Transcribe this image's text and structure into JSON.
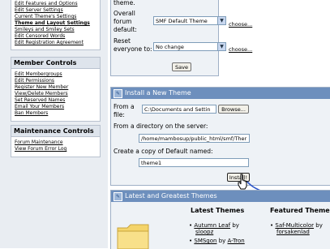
{
  "sidebar": {
    "top_links": [
      {
        "label": "Edit Features and Options",
        "bold": false
      },
      {
        "label": "Edit Server Settings",
        "bold": false
      },
      {
        "label": "Current Theme's Settings",
        "bold": false
      },
      {
        "label": "Theme and Layout Settings",
        "bold": true
      },
      {
        "label": "Smileys and Smiley Sets",
        "bold": false
      },
      {
        "label": "Edit Censored Words",
        "bold": false
      },
      {
        "label": "Edit Registration Agreement",
        "bold": false
      }
    ],
    "member_controls": {
      "title": "Member Controls",
      "links": [
        "Edit Membergroups",
        "Edit Permissions",
        "Register New Member",
        "View/Delete Members",
        "Set Reserved Names",
        "Email Your Members",
        "Ban Members"
      ]
    },
    "maintenance_controls": {
      "title": "Maintenance Controls",
      "links": [
        "Forum Maintenance",
        "View Forum Error Log"
      ]
    }
  },
  "settings_box": {
    "top_text": "theme.",
    "overall_label_lines": [
      "Overall",
      "forum",
      "default:"
    ],
    "overall_value": "SMF Default Theme",
    "reset_label_lines": [
      "Reset",
      "everyone to:"
    ],
    "reset_value": "No change",
    "choose_link": "choose...",
    "save_label": "Save"
  },
  "install_box": {
    "title": "Install a New Theme",
    "from_file_label_lines": [
      "From a",
      "file:"
    ],
    "file_value": "C:\\Documents and Settin",
    "browse_label": "Browse...",
    "from_dir_label": "From a directory on the server:",
    "dir_value": "/home/mambosup/public_html/smf/Ther",
    "copy_label": "Create a copy of Default named:",
    "copy_value": "theme1",
    "install_label": "Install!"
  },
  "latest_box": {
    "title": "Latest and Greatest Themes",
    "latest_heading": "Latest Themes",
    "featured_heading": "Featured Theme",
    "latest_items": [
      {
        "name": "Autumn Leaf",
        "by": "by",
        "author": "sloopz"
      },
      {
        "name": "SMSgon",
        "by": "by",
        "author": "A-Tron"
      }
    ],
    "featured_items": [
      {
        "name": "Saf-Multicolor",
        "by": "by",
        "author": "forsakenlad"
      }
    ]
  }
}
